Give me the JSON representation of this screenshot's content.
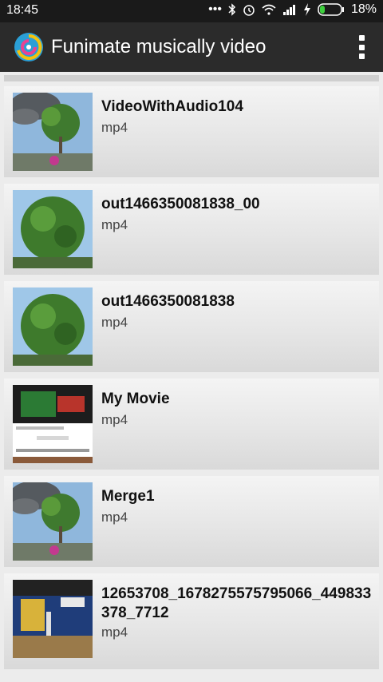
{
  "status_bar": {
    "time": "18:45",
    "battery": "18%",
    "icons": [
      "more-dots-icon",
      "bluetooth-icon",
      "alarm-icon",
      "wifi-icon",
      "signal-icon",
      "charging-icon",
      "battery-icon"
    ]
  },
  "toolbar": {
    "title": "Funimate musically video",
    "menu_icon": "overflow-menu-icon"
  },
  "videos": [
    {
      "name": "VideoWithAudio104",
      "type": "mp4",
      "thumb": "smoke-tree"
    },
    {
      "name": "out1466350081838_00",
      "type": "mp4",
      "thumb": "tree"
    },
    {
      "name": "out1466350081838",
      "type": "mp4",
      "thumb": "tree"
    },
    {
      "name": "My Movie",
      "type": "mp4",
      "thumb": "webpage"
    },
    {
      "name": "Merge1",
      "type": "mp4",
      "thumb": "smoke-tree"
    },
    {
      "name": "12653708_1678275575795066_449833378_7712",
      "type": "mp4",
      "thumb": "gym"
    }
  ]
}
